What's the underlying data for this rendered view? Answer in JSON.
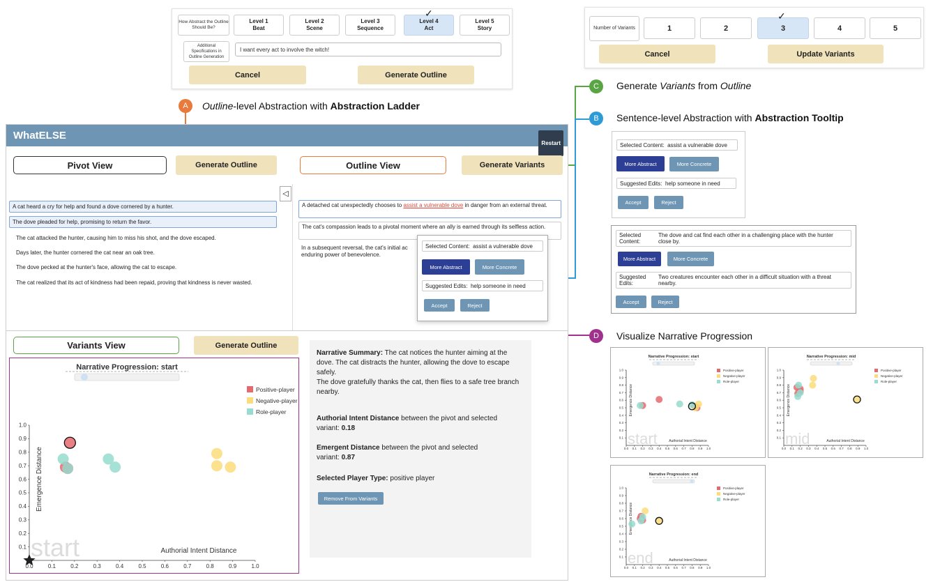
{
  "top_left_panel": {
    "question": "How Abstract the Outline Should Be?",
    "levels": [
      {
        "l1": "Level 1",
        "l2": "Beat"
      },
      {
        "l1": "Level 2",
        "l2": "Scene"
      },
      {
        "l1": "Level 3",
        "l2": "Sequence"
      },
      {
        "l1": "Level 4",
        "l2": "Act"
      },
      {
        "l1": "Level 5",
        "l2": "Story"
      }
    ],
    "check": "✓",
    "spec_label": "Additional Specifications in Outline Generation",
    "spec_value": "I want every act to involve the witch!",
    "cancel": "Cancel",
    "generate": "Generate Outline"
  },
  "top_right_panel": {
    "label": "Number of Variants",
    "options": [
      "1",
      "2",
      "3",
      "4",
      "5"
    ],
    "check": "✓",
    "cancel": "Cancel",
    "update": "Update Variants"
  },
  "callouts": {
    "a": {
      "letter": "A",
      "italic": "Outline",
      "mid": "-level Abstraction with ",
      "bold": "Abstraction Ladder"
    },
    "b": {
      "letter": "B",
      "pre": "Sentence-level Abstraction with ",
      "bold": "Abstraction Tooltip"
    },
    "c": {
      "letter": "C",
      "pre": "Generate ",
      "italic1": "Variants",
      "mid": " from ",
      "italic2": "Outline"
    },
    "d": {
      "letter": "D",
      "text": "Visualize Narrative Progression"
    }
  },
  "colors": {
    "orange": "#e87a3c",
    "green": "#5aa543",
    "blue": "#2e9bd6",
    "purple": "#a0318c"
  },
  "app": {
    "title": "WhatELSE",
    "restart": "Restart",
    "pivot_title": "Pivot View",
    "generate_outline": "Generate Outline",
    "outline_title": "Outline View",
    "generate_variants": "Generate Variants",
    "collapse": "◁",
    "pivot_rows": [
      "A cat heard a cry for help and found a dove cornered by a hunter.",
      "The dove pleaded for help, promising to return the favor.",
      "The cat attacked the hunter, causing him to miss his shot, and the dove escaped.",
      "Days later, the hunter cornered the cat near an oak tree.",
      "The dove pecked at the hunter's face, allowing the cat to escape.",
      "The cat realized that its act of kindness had been repaid, proving that kindness is never wasted."
    ],
    "outline_rows": {
      "r1_pre": "A detached cat unexpectedly chooses to ",
      "r1_link": "assist a vulnerable dove",
      "r1_post": " in danger from an external threat.",
      "r2": "The cat's compassion leads to a pivotal moment where an ally is earned through its selfless action.",
      "r3a": "In a subsequent reversal, the cat's initial ac",
      "r3b": "enduring power of benevolence."
    },
    "variants_title": "Variants View",
    "generate_outline2": "Generate Outline",
    "summary": {
      "label": "Narrative Summary:",
      "text": " The cat notices the hunter aiming at the dove. The cat distracts the hunter, allowing the dove to escape safely.",
      "text2": "The dove gratefully thanks the cat, then flies to a safe tree branch nearby.",
      "aid_bold": "Authorial Intent Distance",
      "aid_text": " between the pivot and selected variant: ",
      "aid_val": "0.18",
      "ed_bold": "Emergent Distance",
      "ed_text": " between the pivot and selected variant: ",
      "ed_val": "0.87",
      "pt_bold": "Selected Player Type:",
      "pt_text": " positive player",
      "remove": "Remove From Variants"
    }
  },
  "tooltip": {
    "sel_label": "Selected Content:",
    "sel_value": "assist a vulnerable dove",
    "more_abstract": "More Abstract",
    "more_concrete": "More Concrete",
    "sug_label": "Suggested Edits:",
    "sug_value": "help someone in need",
    "accept": "Accept",
    "reject": "Reject"
  },
  "tooltip2": {
    "sel_label": "Selected Content:",
    "sel_value": "The dove and cat find each other in a challenging place with the hunter close by.",
    "more_abstract": "More Abstract",
    "more_concrete": "More Concrete",
    "sug_label": "Suggested Edits:",
    "sug_value": "Two creatures encounter each other in a difficult situation with a threat nearby.",
    "accept": "Accept",
    "reject": "Reject"
  },
  "chart_data": [
    {
      "type": "scatter",
      "title": "Narrative Progression: start",
      "stage": "start",
      "xlabel": "Authorial Intent Distance",
      "ylabel": "Emergence Distance",
      "xlim": [
        0,
        1
      ],
      "ylim": [
        0,
        1
      ],
      "xticks": [
        "0.0",
        "0.1",
        "0.2",
        "0.3",
        "0.4",
        "0.5",
        "0.6",
        "0.7",
        "0.8",
        "0.9",
        "1.0"
      ],
      "yticks": [
        "0.0",
        "0.1",
        "0.2",
        "0.3",
        "0.4",
        "0.5",
        "0.6",
        "0.7",
        "0.8",
        "0.9",
        "1.0"
      ],
      "legend": [
        {
          "name": "Positive-player",
          "color": "#e46a6e"
        },
        {
          "name": "Negative-player",
          "color": "#fbdc7a"
        },
        {
          "name": "Role-player",
          "color": "#97dccf"
        }
      ],
      "legend_position": "top-right",
      "series": [
        {
          "name": "Positive-player",
          "color": "#e46a6e",
          "points": [
            [
              0.18,
              0.87
            ],
            [
              0.17,
              0.68
            ],
            [
              0.16,
              0.69
            ]
          ]
        },
        {
          "name": "Negative-player",
          "color": "#fbdc7a",
          "points": [
            [
              0.83,
              0.79
            ],
            [
              0.83,
              0.7
            ],
            [
              0.89,
              0.69
            ]
          ]
        },
        {
          "name": "Role-player",
          "color": "#97dccf",
          "points": [
            [
              0.15,
              0.75
            ],
            [
              0.35,
              0.75
            ],
            [
              0.38,
              0.69
            ],
            [
              0.17,
              0.68
            ]
          ]
        }
      ],
      "selected": [
        0.18,
        0.87
      ],
      "pivot": [
        0.0,
        0.0
      ]
    },
    {
      "type": "scatter",
      "title": "Narrative Progression: start",
      "stage": "start",
      "xlabel": "Authorial Intent Distance",
      "ylabel": "Emergence Distance",
      "xlim": [
        0,
        1
      ],
      "ylim": [
        0,
        1
      ],
      "series": [
        {
          "name": "Positive-player",
          "color": "#e46a6e",
          "points": [
            [
              0.2,
              0.53
            ],
            [
              0.4,
              0.61
            ],
            [
              0.83,
              0.52
            ],
            [
              0.86,
              0.5
            ]
          ]
        },
        {
          "name": "Negative-player",
          "color": "#fbdc7a",
          "points": [
            [
              0.88,
              0.55
            ],
            [
              0.84,
              0.5
            ]
          ]
        },
        {
          "name": "Role-player",
          "color": "#97dccf",
          "points": [
            [
              0.17,
              0.53
            ],
            [
              0.65,
              0.55
            ],
            [
              0.8,
              0.54
            ]
          ]
        }
      ],
      "selected": [
        0.8,
        0.52
      ]
    },
    {
      "type": "scatter",
      "title": "Narrative Progression: mid",
      "stage": "mid",
      "xlabel": "Authorial Intent Distance",
      "ylabel": "Emergence Distance",
      "xlim": [
        0,
        1
      ],
      "ylim": [
        0,
        1
      ],
      "series": [
        {
          "name": "Positive-player",
          "color": "#e46a6e",
          "points": [
            [
              0.16,
              0.77
            ],
            [
              0.2,
              0.75
            ],
            [
              0.17,
              0.69
            ],
            [
              0.2,
              0.72
            ]
          ]
        },
        {
          "name": "Negative-player",
          "color": "#fbdc7a",
          "points": [
            [
              0.35,
              0.8
            ],
            [
              0.36,
              0.89
            ],
            [
              0.89,
              0.61
            ]
          ]
        },
        {
          "name": "Role-player",
          "color": "#97dccf",
          "points": [
            [
              0.18,
              0.8
            ],
            [
              0.17,
              0.65
            ],
            [
              0.2,
              0.7
            ]
          ]
        }
      ],
      "selected": [
        0.89,
        0.61
      ]
    },
    {
      "type": "scatter",
      "title": "Narrative Progression: end",
      "stage": "end",
      "xlabel": "Authorial Intent Distance",
      "ylabel": "Emergence Distance",
      "xlim": [
        0,
        1
      ],
      "ylim": [
        0,
        1
      ],
      "series": [
        {
          "name": "Positive-player",
          "color": "#e46a6e",
          "points": [
            [
              0.17,
              0.6
            ],
            [
              0.2,
              0.58
            ],
            [
              0.18,
              0.63
            ]
          ]
        },
        {
          "name": "Negative-player",
          "color": "#fbdc7a",
          "points": [
            [
              0.23,
              0.7
            ],
            [
              0.4,
              0.57
            ]
          ]
        },
        {
          "name": "Role-player",
          "color": "#97dccf",
          "points": [
            [
              0.07,
              0.53
            ],
            [
              0.18,
              0.57
            ],
            [
              0.2,
              0.62
            ]
          ]
        }
      ],
      "selected": [
        0.4,
        0.57
      ]
    }
  ]
}
